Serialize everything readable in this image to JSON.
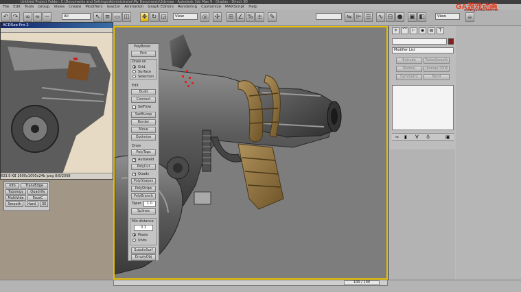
{
  "window": {
    "title": "Untitled  Project Folder: C:\\Documents and Settings\\Administrator\\My Documents\\3dsmax   -   Autodesk 3ds Max 9   -   Display : Direct 3D"
  },
  "menu": [
    "File",
    "Edit",
    "Tools",
    "Group",
    "Views",
    "Create",
    "Modifiers",
    "reactor",
    "Animation",
    "Graph Editors",
    "Rendering",
    "Customize",
    "MAXScript",
    "Help"
  ],
  "toolbar": {
    "selection_filter": "All",
    "view_dropdown": "View",
    "named_selection": "",
    "right_view": "View"
  },
  "brand": {
    "logo_text": "GA游戏动画",
    "url": "www.gamea.com.cn"
  },
  "reference_window": {
    "title": "ACDSee Pro 2",
    "status": "633.9 KB   1600x1000x24b jpeg   8/8/2008"
  },
  "tool_panel": {
    "header": "PolyBoost",
    "button_pick": "Pick",
    "draw_on_label": "Draw on",
    "draw_on_options": [
      "Grid",
      "Surface",
      "Selection"
    ],
    "draw_on_selected": "Grid",
    "edit_label": "Edit",
    "edit_buttons": [
      "Build",
      "Connect",
      "SelFlow",
      "SwiftLoop",
      "Border",
      "Move",
      "Optimize"
    ],
    "draw_label": "Draw",
    "draw_buttons": [
      "PolyTops",
      "PolyCut",
      "PolyShapes",
      "PolyStrips",
      "PolyBranch"
    ],
    "autoweld_label": "Autoweld",
    "quads_label": "Quads",
    "taper_label": "Taper",
    "taper_value": "1.0",
    "splines_button": "Splines",
    "min_distance_label": "Min distance",
    "min_distance_value": "0.1",
    "units_options": [
      "Pixels",
      "Units"
    ],
    "units_selected": "Pixels",
    "bottom_buttons": [
      "SubdivSurf",
      "EmptyObj"
    ]
  },
  "mini_panel": {
    "row1": [
      "Info",
      "TransEdge"
    ],
    "row2": [
      "Topology",
      "Quadrify"
    ],
    "row3": [
      "MultiVide",
      "FaceC"
    ],
    "row4": [
      "Smooth",
      "Hard",
      "30"
    ]
  },
  "command_panel": {
    "tabs_icons": [
      "create-icon",
      "modify-icon",
      "hierarchy-icon",
      "motion-icon",
      "display-icon",
      "utilities-icon"
    ],
    "name_field": "",
    "color_swatch": "#8b1a1a",
    "modifier_list": "Modifier List",
    "buttons": [
      [
        "Extrude",
        "TurboSmooth"
      ],
      [
        "Normal",
        "Unwrap UVW"
      ],
      [
        "Symmetry",
        "Bend"
      ]
    ]
  },
  "status": {
    "frame_counter": "100 / 100"
  }
}
